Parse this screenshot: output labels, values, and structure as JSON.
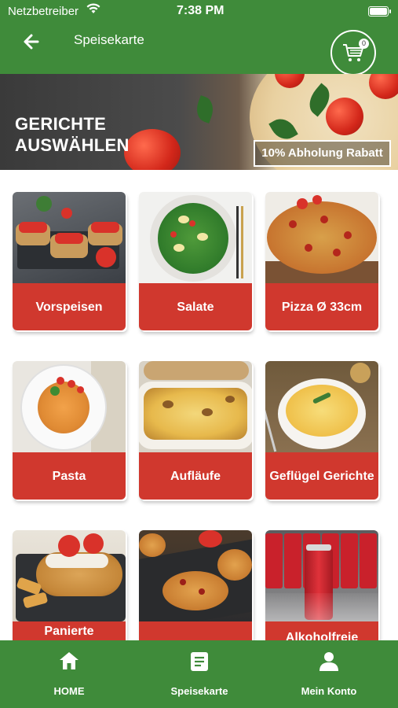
{
  "status_bar": {
    "carrier": "Netzbetreiber",
    "time": "7:38 PM"
  },
  "app_bar": {
    "title": "Speisekarte",
    "cart_count": "0"
  },
  "banner": {
    "heading_line1": "GERICHTE",
    "heading_line2": "AUSWÄHLEN",
    "promo": "10% Abholung Rabatt"
  },
  "categories": [
    {
      "label": "Vorspeisen",
      "image": "bruschetta"
    },
    {
      "label": "Salate",
      "image": "salad-bowl"
    },
    {
      "label": "Pizza Ø 33cm",
      "image": "pizza"
    },
    {
      "label": "Pasta",
      "image": "spaghetti"
    },
    {
      "label": "Aufläufe",
      "image": "casserole"
    },
    {
      "label": "Geflügel Gerichte",
      "image": "gratin-dish"
    },
    {
      "label": "Panierte",
      "image": "schnitzel"
    },
    {
      "label": "",
      "image": "mini-pizzas"
    },
    {
      "label": "Alkoholfreie",
      "image": "cola-cans"
    }
  ],
  "bottom_nav": [
    {
      "label": "HOME",
      "icon": "home-icon"
    },
    {
      "label": "Speisekarte",
      "icon": "menu-list-icon"
    },
    {
      "label": "Mein Konto",
      "icon": "account-icon"
    }
  ],
  "colors": {
    "primary_green": "#3f8b3a",
    "card_red": "#d0382e"
  }
}
